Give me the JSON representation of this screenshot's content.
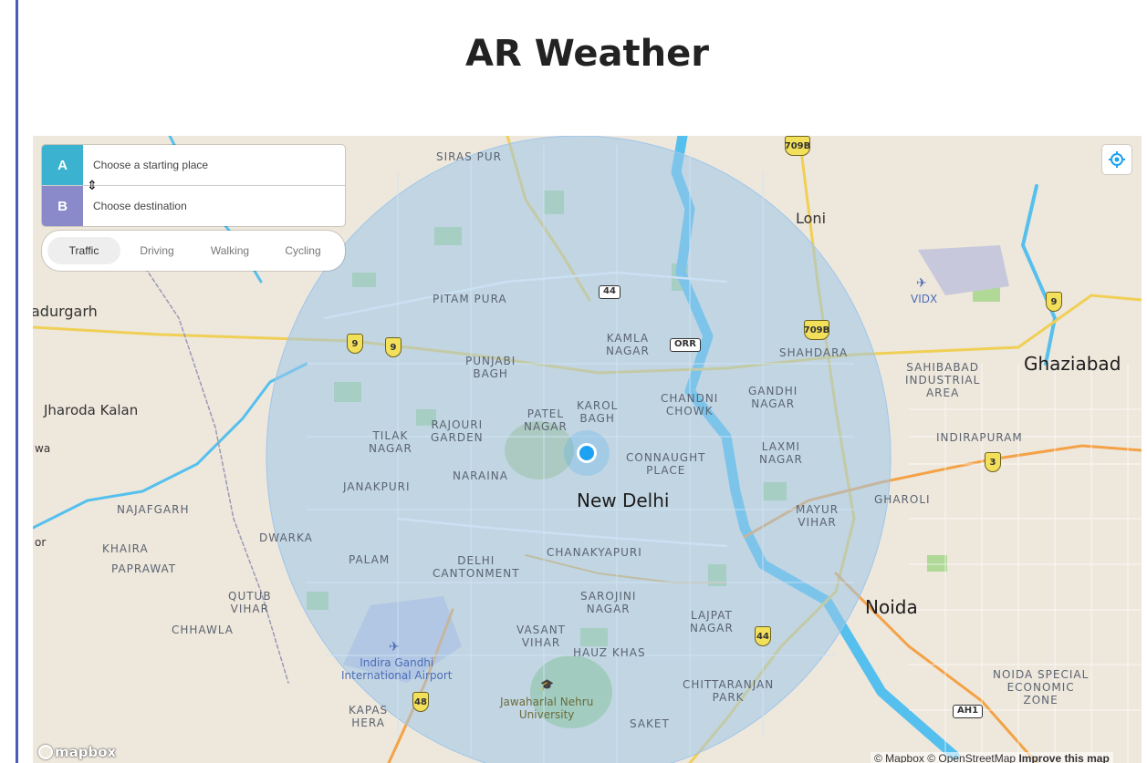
{
  "page": {
    "title": "AR Weather"
  },
  "directions": {
    "origin": {
      "letter": "A",
      "placeholder": "Choose a starting place"
    },
    "destination": {
      "letter": "B",
      "placeholder": "Choose destination"
    },
    "reverse_icon": "swap-vertical-icon",
    "profiles": [
      {
        "label": "Traffic",
        "active": true
      },
      {
        "label": "Driving",
        "active": false
      },
      {
        "label": "Walking",
        "active": false
      },
      {
        "label": "Cycling",
        "active": false
      }
    ]
  },
  "controls": {
    "geolocate_icon": "geolocate-icon"
  },
  "map": {
    "colors": {
      "land": "#eee7dc",
      "water": "#55c0ee",
      "park": "#a9d68f",
      "radius": "#9fc6ea",
      "user_dot": "#1da1f2"
    },
    "labels": {
      "siras_pur": "SIRAS PUR",
      "loni": "Loni",
      "vidx": "VIDX",
      "bahadurgarh": "adurgarh",
      "pitam_pura": "PITAM PURA",
      "kamla_nagar": "KAMLA\nNAGAR",
      "shahdara": "SHAHDARA",
      "sahibabad": "SAHIBABAD\nINDUSTRIAL\nAREA",
      "ghaziabad": "Ghaziabad",
      "punjabi_bagh": "PUNJABI\nBAGH",
      "jharoda_kalan": "Jharoda Kalan",
      "karol_bagh": "KAROL\nBAGH",
      "chandni_chowk": "CHANDNI\nCHOWK",
      "gandhi_nagar": "GANDHI\nNAGAR",
      "patel_nagar": "PATEL\nNAGAR",
      "rajouri_garden": "RAJOURI\nGARDEN",
      "tilak_nagar": "TILAK\nNAGAR",
      "indirapuram": "INDIRAPURAM",
      "wa": "wa",
      "connaught_place": "CONNAUGHT\nPLACE",
      "laxmi_nagar": "LAXMI\nNAGAR",
      "naraina": "NARAINA",
      "janakpuri": "JANAKPURI",
      "new_delhi": "New Delhi",
      "gharoli": "GHAROLI",
      "najafgarh": "NAJAFGARH",
      "mayur_vihar": "MAYUR\nVIHAR",
      "dwarka": "DWARKA",
      "or": "or",
      "khaira": "KHAIRA",
      "paprawat": "PAPRAWAT",
      "palam": "PALAM",
      "delhi_cantonment": "DELHI\nCANTONMENT",
      "chanakyapuri": "CHANAKYAPURI",
      "qutub_vihar": "QUTUB\nVIHAR",
      "sarojini_nagar": "SAROJINI\nNAGAR",
      "noida": "Noida",
      "chhawla": "CHHAWLA",
      "lajpat_nagar": "LAJPAT\nNAGAR",
      "vasant_vihar": "VASANT\nVIHAR",
      "airport": "Indira Gandhi\nInternational Airport",
      "hauz_khas": "HAUZ KHAS",
      "noida_sez": "NOIDA SPECIAL\nECONOMIC\nZONE",
      "chittaranjan_park": "CHITTARANJAN\nPARK",
      "jnu": "Jawaharlal Nehru\nUniversity",
      "kapas_hera": "KAPAS\nHERA",
      "saket": "SAKET"
    },
    "shields": [
      "709B",
      "709B",
      "9",
      "9",
      "9",
      "3",
      "44",
      "48"
    ],
    "badges": [
      "44",
      "ORR",
      "AH1"
    ]
  },
  "footer": {
    "logo": "mapbox",
    "attribution": "© Mapbox © OpenStreetMap",
    "improve": "Improve this map"
  }
}
